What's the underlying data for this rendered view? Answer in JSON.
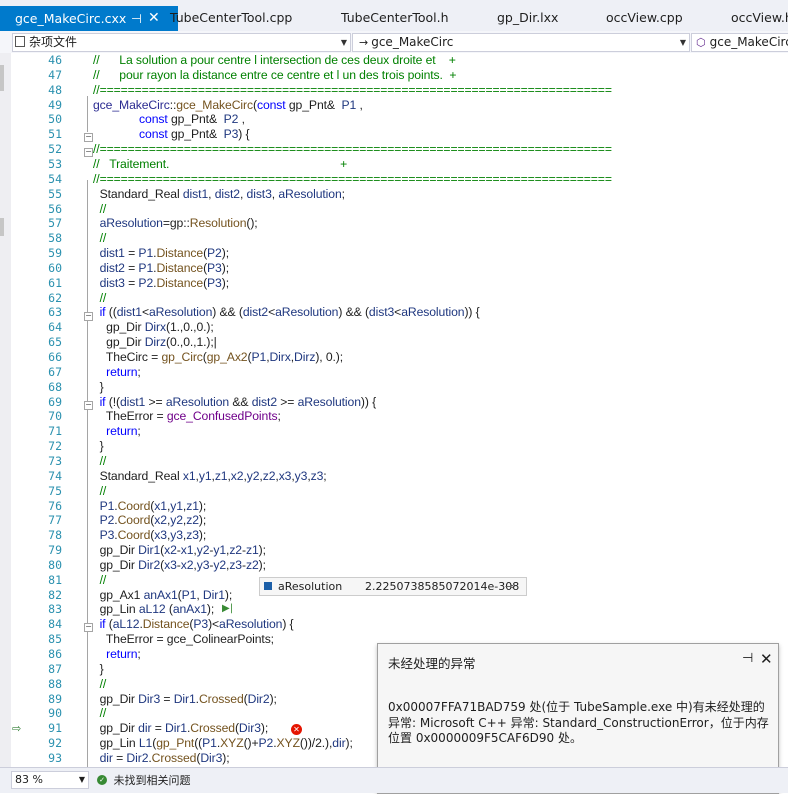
{
  "tabs": [
    {
      "label": "gce_MakeCirc.cxx",
      "active": true
    },
    {
      "label": "TubeCenterTool.cpp"
    },
    {
      "label": "TubeCenterTool.h"
    },
    {
      "label": "gp_Dir.lxx"
    },
    {
      "label": "occView.cpp"
    },
    {
      "label": "occView.h"
    }
  ],
  "tab_pin_glyph": "⊣",
  "tab_close_glyph": "✕",
  "nav": {
    "project": "杂项文件",
    "scope": "gce_MakeCirc",
    "member": "gce_MakeCirc"
  },
  "line_numbers": [
    "46",
    "47",
    "48",
    "49",
    "50",
    "51",
    "52",
    "53",
    "54",
    "55",
    "56",
    "57",
    "58",
    "59",
    "60",
    "61",
    "62",
    "63",
    "64",
    "65",
    "66",
    "67",
    "68",
    "69",
    "70",
    "71",
    "72",
    "73",
    "74",
    "75",
    "76",
    "77",
    "78",
    "79",
    "80",
    "81",
    "82",
    "83",
    "84",
    "85",
    "86",
    "87",
    "88",
    "89",
    "90",
    "91",
    "92",
    "93"
  ],
  "code_lines": [
    [
      [
        "cm",
        "//      La solution a pour centre l intersection de ces deux droite et    +"
      ]
    ],
    [
      [
        "cm",
        "//      pour rayon la distance entre ce centre et l un des trois points.  +"
      ]
    ],
    [
      [
        "cm",
        "//========================================================================="
      ]
    ],
    [
      [
        "ty",
        "gce_MakeCirc"
      ],
      [
        "",
        "::"
      ],
      [
        "fn",
        "gce_MakeCirc"
      ],
      [
        "",
        "("
      ],
      [
        "kw",
        "const"
      ],
      [
        "",
        " gp_Pnt&  "
      ],
      [
        "pr",
        "P1"
      ],
      [
        "",
        " ,"
      ]
    ],
    [
      [
        "",
        "              "
      ],
      [
        "kw",
        "const"
      ],
      [
        "",
        " gp_Pnt&  "
      ],
      [
        "pr",
        "P2"
      ],
      [
        "",
        " ,"
      ]
    ],
    [
      [
        "",
        "              "
      ],
      [
        "kw",
        "const"
      ],
      [
        "",
        " gp_Pnt&  "
      ],
      [
        "pr",
        "P3"
      ],
      [
        "",
        ") {"
      ]
    ],
    [
      [
        "cm",
        "//========================================================================="
      ]
    ],
    [
      [
        "cm",
        "//   Traitement.                                                    +"
      ]
    ],
    [
      [
        "cm",
        "//========================================================================="
      ]
    ],
    [
      [
        "",
        "  Standard_Real "
      ],
      [
        "var",
        "dist1"
      ],
      [
        "",
        ", "
      ],
      [
        "var",
        "dist2"
      ],
      [
        "",
        ", "
      ],
      [
        "var",
        "dist3"
      ],
      [
        "",
        ", "
      ],
      [
        "var",
        "aResolution"
      ],
      [
        "",
        ";"
      ]
    ],
    [
      [
        "cm",
        "  //"
      ]
    ],
    [
      [
        "",
        "  "
      ],
      [
        "var",
        "aResolution"
      ],
      [
        "",
        "=gp::"
      ],
      [
        "fn",
        "Resolution"
      ],
      [
        "",
        "();"
      ]
    ],
    [
      [
        "cm",
        "  //"
      ]
    ],
    [
      [
        "",
        "  "
      ],
      [
        "var",
        "dist1"
      ],
      [
        "",
        " = "
      ],
      [
        "pr",
        "P1"
      ],
      [
        "",
        "."
      ],
      [
        "fn",
        "Distance"
      ],
      [
        "",
        "("
      ],
      [
        "pr",
        "P2"
      ],
      [
        "",
        ");"
      ]
    ],
    [
      [
        "",
        "  "
      ],
      [
        "var",
        "dist2"
      ],
      [
        "",
        " = "
      ],
      [
        "pr",
        "P1"
      ],
      [
        "",
        "."
      ],
      [
        "fn",
        "Distance"
      ],
      [
        "",
        "("
      ],
      [
        "pr",
        "P3"
      ],
      [
        "",
        ");"
      ]
    ],
    [
      [
        "",
        "  "
      ],
      [
        "var",
        "dist3"
      ],
      [
        "",
        " = "
      ],
      [
        "pr",
        "P2"
      ],
      [
        "",
        "."
      ],
      [
        "fn",
        "Distance"
      ],
      [
        "",
        "("
      ],
      [
        "pr",
        "P3"
      ],
      [
        "",
        ");"
      ]
    ],
    [
      [
        "cm",
        "  //"
      ]
    ],
    [
      [
        "",
        "  "
      ],
      [
        "kw",
        "if"
      ],
      [
        "",
        " (("
      ],
      [
        "var",
        "dist1"
      ],
      [
        "",
        "<"
      ],
      [
        "var",
        "aResolution"
      ],
      [
        "",
        ") && ("
      ],
      [
        "var",
        "dist2"
      ],
      [
        "",
        "<"
      ],
      [
        "var",
        "aResolution"
      ],
      [
        "",
        ") && ("
      ],
      [
        "var",
        "dist3"
      ],
      [
        "",
        "<"
      ],
      [
        "var",
        "aResolution"
      ],
      [
        "",
        ")) {"
      ]
    ],
    [
      [
        "",
        "    gp_Dir "
      ],
      [
        "var",
        "Dirx"
      ],
      [
        "",
        "(1.,0.,0.);"
      ]
    ],
    [
      [
        "",
        "    gp_Dir "
      ],
      [
        "var",
        "Dirz"
      ],
      [
        "",
        "(0.,0.,1.);|"
      ]
    ],
    [
      [
        "",
        "    TheCirc = "
      ],
      [
        "fn",
        "gp_Circ"
      ],
      [
        "",
        "("
      ],
      [
        "fn",
        "gp_Ax2"
      ],
      [
        "",
        "("
      ],
      [
        "pr",
        "P1"
      ],
      [
        "",
        ","
      ],
      [
        "var",
        "Dirx"
      ],
      [
        "",
        ","
      ],
      [
        "var",
        "Dirz"
      ],
      [
        "",
        "), 0.);"
      ]
    ],
    [
      [
        "",
        "    "
      ],
      [
        "kw",
        "return"
      ],
      [
        "",
        ";"
      ]
    ],
    [
      [
        "",
        "  }"
      ]
    ],
    [
      [
        "",
        "  "
      ],
      [
        "kw",
        "if"
      ],
      [
        "",
        " (!("
      ],
      [
        "var",
        "dist1"
      ],
      [
        "",
        " >= "
      ],
      [
        "var",
        "aResolution"
      ],
      [
        "",
        " && "
      ],
      [
        "var",
        "dist2"
      ],
      [
        "",
        " >= "
      ],
      [
        "var",
        "aResolution"
      ],
      [
        "",
        ")) {"
      ]
    ],
    [
      [
        "",
        "    TheError = "
      ],
      [
        "mac",
        "gce_ConfusedPoints"
      ],
      [
        "",
        ";"
      ]
    ],
    [
      [
        "",
        "    "
      ],
      [
        "kw",
        "return"
      ],
      [
        "",
        ";"
      ]
    ],
    [
      [
        "",
        "  }"
      ]
    ],
    [
      [
        "cm",
        "  //"
      ]
    ],
    [
      [
        "",
        "  Standard_Real "
      ],
      [
        "var",
        "x1"
      ],
      [
        "",
        ","
      ],
      [
        "var",
        "y1"
      ],
      [
        "",
        ","
      ],
      [
        "var",
        "z1"
      ],
      [
        "",
        ","
      ],
      [
        "var",
        "x2"
      ],
      [
        "",
        ","
      ],
      [
        "var",
        "y2"
      ],
      [
        "",
        ","
      ],
      [
        "var",
        "z2"
      ],
      [
        "",
        ","
      ],
      [
        "var",
        "x3"
      ],
      [
        "",
        ","
      ],
      [
        "var",
        "y3"
      ],
      [
        "",
        ","
      ],
      [
        "var",
        "z3"
      ],
      [
        "",
        ";"
      ]
    ],
    [
      [
        "cm",
        "  //"
      ]
    ],
    [
      [
        "",
        "  "
      ],
      [
        "pr",
        "P1"
      ],
      [
        "",
        "."
      ],
      [
        "fn",
        "Coord"
      ],
      [
        "",
        "("
      ],
      [
        "var",
        "x1"
      ],
      [
        "",
        ","
      ],
      [
        "var",
        "y1"
      ],
      [
        "",
        ","
      ],
      [
        "var",
        "z1"
      ],
      [
        "",
        ");"
      ]
    ],
    [
      [
        "",
        "  "
      ],
      [
        "pr",
        "P2"
      ],
      [
        "",
        "."
      ],
      [
        "fn",
        "Coord"
      ],
      [
        "",
        "("
      ],
      [
        "var",
        "x2"
      ],
      [
        "",
        ","
      ],
      [
        "var",
        "y2"
      ],
      [
        "",
        ","
      ],
      [
        "var",
        "z2"
      ],
      [
        "",
        ");"
      ]
    ],
    [
      [
        "",
        "  "
      ],
      [
        "pr",
        "P3"
      ],
      [
        "",
        "."
      ],
      [
        "fn",
        "Coord"
      ],
      [
        "",
        "("
      ],
      [
        "var",
        "x3"
      ],
      [
        "",
        ","
      ],
      [
        "var",
        "y3"
      ],
      [
        "",
        ","
      ],
      [
        "var",
        "z3"
      ],
      [
        "",
        ");"
      ]
    ],
    [
      [
        "",
        "  gp_Dir "
      ],
      [
        "var",
        "Dir1"
      ],
      [
        "",
        "("
      ],
      [
        "var",
        "x2"
      ],
      [
        "",
        "-"
      ],
      [
        "var",
        "x1"
      ],
      [
        "",
        ","
      ],
      [
        "var",
        "y2"
      ],
      [
        "",
        "-"
      ],
      [
        "var",
        "y1"
      ],
      [
        "",
        ","
      ],
      [
        "var",
        "z2"
      ],
      [
        "",
        "-"
      ],
      [
        "var",
        "z1"
      ],
      [
        "",
        ");"
      ]
    ],
    [
      [
        "",
        "  gp_Dir "
      ],
      [
        "var",
        "Dir2"
      ],
      [
        "",
        "("
      ],
      [
        "var",
        "x3"
      ],
      [
        "",
        "-"
      ],
      [
        "var",
        "x2"
      ],
      [
        "",
        ","
      ],
      [
        "var",
        "y3"
      ],
      [
        "",
        "-"
      ],
      [
        "var",
        "y2"
      ],
      [
        "",
        ","
      ],
      [
        "var",
        "z3"
      ],
      [
        "",
        "-"
      ],
      [
        "var",
        "z2"
      ],
      [
        "",
        ");"
      ]
    ],
    [
      [
        "cm",
        "  //"
      ]
    ],
    [
      [
        "",
        "  gp_Ax1 "
      ],
      [
        "var",
        "anAx1"
      ],
      [
        "",
        "("
      ],
      [
        "pr",
        "P1"
      ],
      [
        "",
        ", "
      ],
      [
        "var",
        "Dir1"
      ],
      [
        "",
        ");"
      ]
    ],
    [
      [
        "",
        "  gp_Lin "
      ],
      [
        "var",
        "aL12"
      ],
      [
        "",
        " ("
      ],
      [
        "var",
        "anAx1"
      ],
      [
        "",
        ");"
      ]
    ],
    [
      [
        "",
        "  "
      ],
      [
        "kw",
        "if"
      ],
      [
        "",
        " ("
      ],
      [
        "var",
        "aL12"
      ],
      [
        "",
        "."
      ],
      [
        "fn",
        "Distance"
      ],
      [
        "",
        "("
      ],
      [
        "pr",
        "P3"
      ],
      [
        "",
        ")<"
      ],
      [
        "var",
        "aResolution"
      ],
      [
        "",
        ") {"
      ]
    ],
    [
      [
        "",
        "    TheError = gce_ColinearPoints;"
      ]
    ],
    [
      [
        "",
        "    "
      ],
      [
        "kw",
        "return"
      ],
      [
        "",
        ";"
      ]
    ],
    [
      [
        "",
        "  }"
      ]
    ],
    [
      [
        "cm",
        "  //"
      ]
    ],
    [
      [
        "",
        "  gp_Dir "
      ],
      [
        "var",
        "Dir3"
      ],
      [
        "",
        " = "
      ],
      [
        "var",
        "Dir1"
      ],
      [
        "",
        "."
      ],
      [
        "fn",
        "Crossed"
      ],
      [
        "",
        "("
      ],
      [
        "var",
        "Dir2"
      ],
      [
        "",
        ");"
      ]
    ],
    [
      [
        "cm",
        "  //"
      ]
    ],
    [
      [
        "",
        "  gp_Dir "
      ],
      [
        "var",
        "dir"
      ],
      [
        "",
        " = "
      ],
      [
        "var",
        "Dir1"
      ],
      [
        "",
        "."
      ],
      [
        "fn",
        "Crossed"
      ],
      [
        "",
        "("
      ],
      [
        "var",
        "Dir3"
      ],
      [
        "",
        ");"
      ]
    ],
    [
      [
        "",
        "  gp_Lin "
      ],
      [
        "var",
        "L1"
      ],
      [
        "",
        "("
      ],
      [
        "fn",
        "gp_Pnt"
      ],
      [
        "",
        "(("
      ],
      [
        "pr",
        "P1"
      ],
      [
        "",
        "."
      ],
      [
        "fn",
        "XYZ"
      ],
      [
        "",
        "()+"
      ],
      [
        "pr",
        "P2"
      ],
      [
        "",
        "."
      ],
      [
        "fn",
        "XYZ"
      ],
      [
        "",
        "())/2.),"
      ],
      [
        "var",
        "dir"
      ],
      [
        "",
        ");"
      ]
    ],
    [
      [
        "",
        "  "
      ],
      [
        "var",
        "dir"
      ],
      [
        "",
        " = "
      ],
      [
        "var",
        "Dir2"
      ],
      [
        "",
        "."
      ],
      [
        "fn",
        "Crossed"
      ],
      [
        "",
        "("
      ],
      [
        "var",
        "Dir3"
      ],
      [
        "",
        ");"
      ]
    ]
  ],
  "datatip": {
    "name": "aResolution",
    "value": "2.2250738585072014e-308"
  },
  "exception": {
    "title": "未经处理的异常",
    "pin_glyph": "⊣",
    "close_glyph": "✕",
    "line1": "0x00007FFA71BAD759 处(位于 TubeSample.exe 中)有未经处理的",
    "line2": "异常: Microsoft C++ 异常: Standard_ConstructionError，位于内存",
    "line3": "位置 0x0000009F5CAF6D90 处。"
  },
  "status": {
    "zoom": "83 %",
    "issues": "未找到相关问题"
  }
}
